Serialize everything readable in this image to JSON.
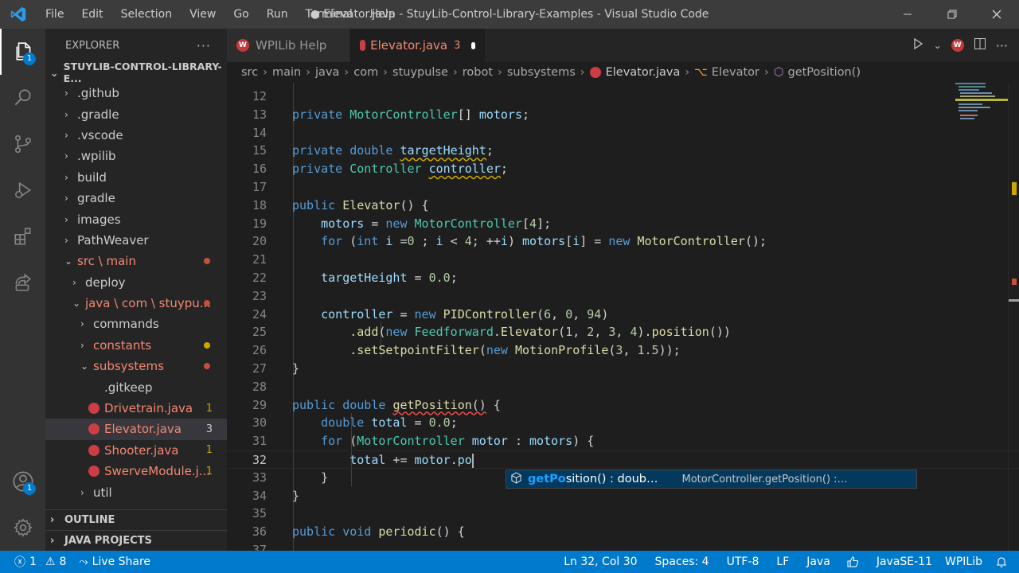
{
  "titlebar": {
    "menu": [
      "File",
      "Edit",
      "Selection",
      "View",
      "Go",
      "Run",
      "Terminal",
      "Help"
    ],
    "title": "● Elevator.java - StuyLib-Control-Library-Examples - Visual Studio Code"
  },
  "activity": {
    "explorer_badge": "1",
    "accounts_badge": "1"
  },
  "explorer": {
    "header": "EXPLORER",
    "root": "STUYLIB-CONTROL-LIBRARY-E...",
    "items": [
      {
        "label": ".github",
        "indent": 0,
        "chev": "›"
      },
      {
        "label": ".gradle",
        "indent": 0,
        "chev": "›"
      },
      {
        "label": ".vscode",
        "indent": 0,
        "chev": "›"
      },
      {
        "label": ".wpilib",
        "indent": 0,
        "chev": "›"
      },
      {
        "label": "build",
        "indent": 0,
        "chev": "›"
      },
      {
        "label": "gradle",
        "indent": 0,
        "chev": "›"
      },
      {
        "label": "images",
        "indent": 0,
        "chev": "›"
      },
      {
        "label": "PathWeaver",
        "indent": 0,
        "chev": "›"
      },
      {
        "label": "src \\ main",
        "indent": 0,
        "chev": "⌄",
        "error": true,
        "dot": "#c74e39"
      },
      {
        "label": "deploy",
        "indent": 1,
        "chev": "›"
      },
      {
        "label": "java \\ com \\ stuypu...",
        "indent": 1,
        "chev": "⌄",
        "error": true,
        "dot": "#c74e39"
      },
      {
        "label": "commands",
        "indent": 2,
        "chev": "›"
      },
      {
        "label": "constants",
        "indent": 2,
        "chev": "›",
        "error": true,
        "dot": "#cca700"
      },
      {
        "label": "subsystems",
        "indent": 2,
        "chev": "⌄",
        "error": true,
        "dot": "#c74e39"
      },
      {
        "label": ".gitkeep",
        "indent": 3,
        "chev": ""
      },
      {
        "label": "Drivetrain.java",
        "indent": 3,
        "chev": "",
        "error": true,
        "java": true,
        "badge": "1"
      },
      {
        "label": "Elevator.java",
        "indent": 3,
        "chev": "",
        "error": true,
        "java": true,
        "badge": "3",
        "selected": true
      },
      {
        "label": "Shooter.java",
        "indent": 3,
        "chev": "",
        "error": true,
        "java": true,
        "badge": "1"
      },
      {
        "label": "SwerveModule.j...",
        "indent": 3,
        "chev": "",
        "error": true,
        "java": true,
        "badge": "1"
      },
      {
        "label": "util",
        "indent": 2,
        "chev": "›"
      }
    ],
    "outline": "OUTLINE",
    "java_projects": "JAVA PROJECTS"
  },
  "tabs": [
    {
      "label": "WPILib Help",
      "active": false
    },
    {
      "label": "Elevator.java",
      "active": true,
      "errors": "3",
      "modified": true
    }
  ],
  "breadcrumb": [
    "src",
    "main",
    "java",
    "com",
    "stuypulse",
    "robot",
    "subsystems",
    "Elevator.java",
    "Elevator",
    "getPosition()"
  ],
  "editor": {
    "lines": [
      {
        "n": "12",
        "html": ""
      },
      {
        "n": "13",
        "html": "<span class='kw'>private</span> <span class='ty'>MotorController</span><span class='pl'>[] </span><span class='vr'>motors</span><span class='pl'>;</span>"
      },
      {
        "n": "14",
        "html": ""
      },
      {
        "n": "15",
        "html": "<span class='kw'>private</span> <span class='kw'>double</span> <span class='vr sqy'>targetHeight</span><span class='pl'>;</span>"
      },
      {
        "n": "16",
        "html": "<span class='kw'>private</span> <span class='ty'>Controller</span> <span class='vr sqy'>controller</span><span class='pl'>;</span>"
      },
      {
        "n": "17",
        "html": ""
      },
      {
        "n": "18",
        "html": "<span class='kw'>public</span> <span class='fn'>Elevator</span><span class='pl'>() {</span>"
      },
      {
        "n": "19",
        "html": "    <span class='vr'>motors</span><span class='pl'> = </span><span class='kw'>new</span> <span class='ty'>MotorController</span><span class='pl'>[</span><span class='nm'>4</span><span class='pl'>];</span>"
      },
      {
        "n": "20",
        "html": "    <span class='kw'>for</span><span class='pl'> (</span><span class='kw'>int</span> <span class='vr'>i</span><span class='pl'> =</span><span class='nm'>0</span><span class='pl'> ; </span><span class='vr'>i</span><span class='pl'> &lt; </span><span class='nm'>4</span><span class='pl'>; ++</span><span class='vr'>i</span><span class='pl'>) </span><span class='vr'>motors</span><span class='pl'>[</span><span class='vr'>i</span><span class='pl'>] = </span><span class='kw'>new</span> <span class='fn'>MotorController</span><span class='pl'>();</span>"
      },
      {
        "n": "21",
        "html": ""
      },
      {
        "n": "22",
        "html": "    <span class='vr'>targetHeight</span><span class='pl'> = </span><span class='nm'>0.0</span><span class='pl'>;</span>"
      },
      {
        "n": "23",
        "html": ""
      },
      {
        "n": "24",
        "html": "    <span class='vr'>controller</span><span class='pl'> = </span><span class='kw'>new</span> <span class='fn'>PIDController</span><span class='pl'>(</span><span class='nm'>6</span><span class='pl'>, </span><span class='nm'>0</span><span class='pl'>, </span><span class='nm'>94</span><span class='pl'>)</span>"
      },
      {
        "n": "25",
        "html": "        <span class='pl'>.</span><span class='fn'>add</span><span class='pl'>(</span><span class='kw'>new</span> <span class='ty'>Feedforward</span><span class='pl'>.</span><span class='fn'>Elevator</span><span class='pl'>(</span><span class='nm'>1</span><span class='pl'>, </span><span class='nm'>2</span><span class='pl'>, </span><span class='nm'>3</span><span class='pl'>, </span><span class='nm'>4</span><span class='pl'>).</span><span class='fn'>position</span><span class='pl'>())</span>"
      },
      {
        "n": "26",
        "html": "        <span class='pl'>.</span><span class='fn'>setSetpointFilter</span><span class='pl'>(</span><span class='kw'>new</span> <span class='fn'>MotionProfile</span><span class='pl'>(</span><span class='nm'>3</span><span class='pl'>, </span><span class='nm'>1.5</span><span class='pl'>));</span>"
      },
      {
        "n": "27",
        "html": "<span class='pl'>}</span>"
      },
      {
        "n": "28",
        "html": ""
      },
      {
        "n": "29",
        "html": "<span class='kw'>public</span> <span class='kw'>double</span> <span class='fn sq'>getPosition</span><span class='pl sq'>()</span><span class='pl'> {</span>"
      },
      {
        "n": "30",
        "html": "    <span class='kw'>double</span> <span class='vr'>total</span><span class='pl'> = </span><span class='nm'>0.0</span><span class='pl'>;</span>"
      },
      {
        "n": "31",
        "html": "    <span class='kw'>for</span><span class='pl'> (</span><span class='ty'>MotorController</span> <span class='vr'>motor</span><span class='pl'> : </span><span class='vr'>motors</span><span class='pl'>) {</span>"
      },
      {
        "n": "32",
        "html": "        <span class='vr'>total</span><span class='pl'> += </span><span class='vr'>motor</span><span class='pl'>.</span><span class='vr'>po</span><span class='cursor'></span>",
        "current": true
      },
      {
        "n": "33",
        "html": "    <span class='pl'>}</span>"
      },
      {
        "n": "34",
        "html": "<span class='pl'>}</span>"
      },
      {
        "n": "35",
        "html": ""
      },
      {
        "n": "36",
        "html": "<span class='kw'>public</span> <span class='kw'>void</span> <span class='fn'>periodic</span><span class='pl'>() {</span>"
      },
      {
        "n": "37",
        "html": ""
      }
    ]
  },
  "suggest": {
    "label_hl": "getPo",
    "label_rest": "sition() : doub…",
    "detail": "MotorController.getPosition() :…"
  },
  "status": {
    "errors": "1",
    "warnings": "8",
    "live_share": "Live Share",
    "position": "Ln 32, Col 30",
    "spaces": "Spaces: 4",
    "encoding": "UTF-8",
    "eol": "LF",
    "language": "Java",
    "java_version": "JavaSE-11",
    "wpilib": "WPILib"
  },
  "colors": {
    "accent": "#007acc",
    "titlebar": "#3c3c3c",
    "sidebar": "#252526",
    "editor": "#1e1e1e",
    "error": "#f48771"
  }
}
